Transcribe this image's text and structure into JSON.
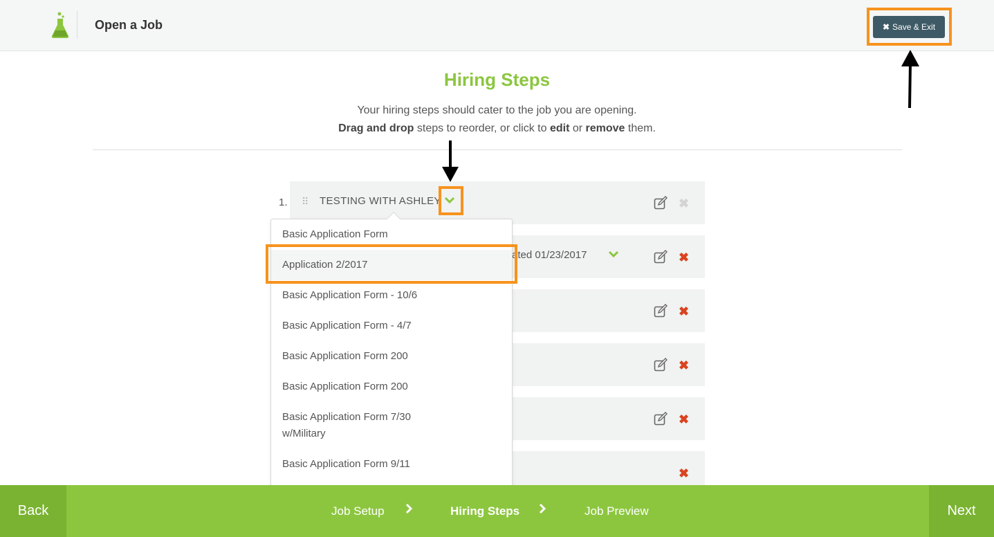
{
  "header": {
    "title": "Open a Job",
    "save_exit_label": "Save & Exit",
    "save_exit_icon": "x-icon"
  },
  "main": {
    "title": "Hiring Steps",
    "subtitle_line1": "Your hiring steps should cater to the job you are opening.",
    "subtitle_bold1": "Drag and drop",
    "subtitle_mid1": " steps to reorder, or click to ",
    "subtitle_bold2": "edit",
    "subtitle_mid2": " or ",
    "subtitle_bold3": "remove",
    "subtitle_end": " them."
  },
  "steps": [
    {
      "number": "1.",
      "name": "TESTING WITH ASHLEY"
    },
    {
      "partial_text": "ated 01/23/2017"
    }
  ],
  "dropdown": {
    "items": [
      "Basic Application Form",
      "Application 2/2017",
      "Basic Application Form - 10/6",
      "Basic Application Form - 4/7",
      "Basic Application Form 200",
      "Basic Application Form 200",
      "Basic Application Form 7/30",
      "w/Military",
      "Basic Application Form 9/11"
    ],
    "selected": "Application 2/2017"
  },
  "footer": {
    "back_label": "Back",
    "next_label": "Next",
    "crumbs": [
      "Job Setup",
      "Hiring Steps",
      "Job Preview"
    ],
    "active_crumb": "Hiring Steps",
    "separator": "›"
  },
  "colors": {
    "brand_green": "#8cc63f",
    "dark_button": "#3d5a66",
    "highlight_orange": "#f7931e",
    "delete_red": "#d9441f"
  }
}
